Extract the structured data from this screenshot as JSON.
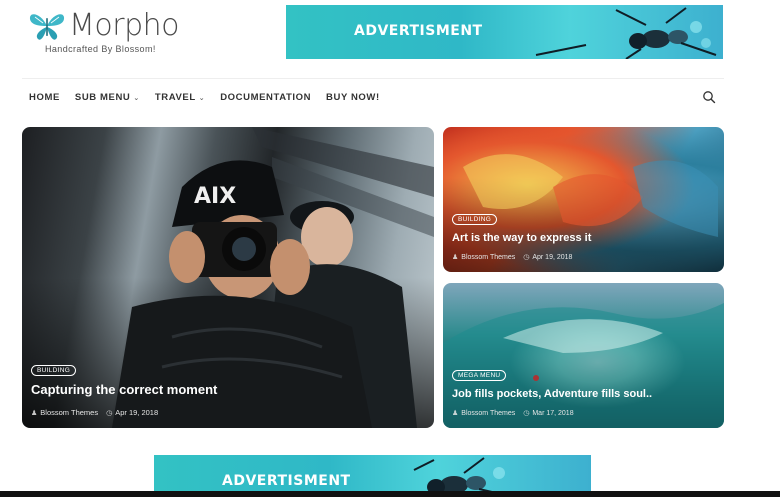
{
  "site": {
    "logo_text": "Morpho",
    "tagline": "Handcrafted By Blossom!",
    "logo_icon": "butterfly-icon",
    "accent_color": "#2fb8c7"
  },
  "ads": {
    "top_label": "ADVERTISMENT",
    "bottom_label": "ADVERTISMENT"
  },
  "nav": {
    "items": [
      {
        "label": "HOME"
      },
      {
        "label": "SUB MENU",
        "dropdown": true
      },
      {
        "label": "TRAVEL",
        "dropdown": true
      },
      {
        "label": "DOCUMENTATION"
      },
      {
        "label": "BUY NOW!"
      }
    ],
    "search_icon": "search-icon"
  },
  "featured": {
    "main": {
      "category": "BUILDING",
      "title": "Capturing the correct moment",
      "author": "Blossom Themes",
      "date": "Apr 19, 2018"
    },
    "art": {
      "category": "BUILDING",
      "title": "Art is the way to express it",
      "author": "Blossom Themes",
      "date": "Apr 19, 2018"
    },
    "wave": {
      "category": "MEGA MENU",
      "title": "Job fills pockets, Adventure fills soul..",
      "author": "Blossom Themes",
      "date": "Mar 17, 2018"
    }
  }
}
